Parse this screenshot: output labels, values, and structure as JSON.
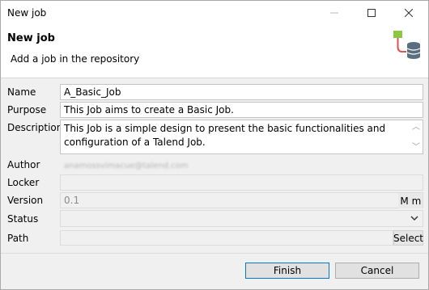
{
  "window": {
    "title": "New job",
    "controls": {
      "minimize": "—",
      "maximize": "☐",
      "close": "✕"
    }
  },
  "header": {
    "title": "New job",
    "description": "Add a job in the repository",
    "logo_icon": "job-repository-icon"
  },
  "form": {
    "name": {
      "label": "Name",
      "value": "A_Basic_Job"
    },
    "purpose": {
      "label": "Purpose",
      "value": "This Job aims to create a Basic Job."
    },
    "description": {
      "label": "Description",
      "value": "This Job is a simple design to present the basic functionalities and configuration of a Talend Job."
    },
    "author": {
      "label": "Author",
      "value": "anamossvimacue@talend.com"
    },
    "locker": {
      "label": "Locker",
      "value": ""
    },
    "version": {
      "label": "Version",
      "value": "0.1",
      "major_button": "M",
      "minor_button": "m"
    },
    "status": {
      "label": "Status",
      "value": ""
    },
    "path": {
      "label": "Path",
      "value": "",
      "select_button": "Select"
    }
  },
  "buttons": {
    "finish": "Finish",
    "cancel": "Cancel"
  },
  "colors": {
    "focus_border": "#0078d7",
    "header_bg": "#ffffff",
    "body_bg": "#f0f0f0"
  }
}
